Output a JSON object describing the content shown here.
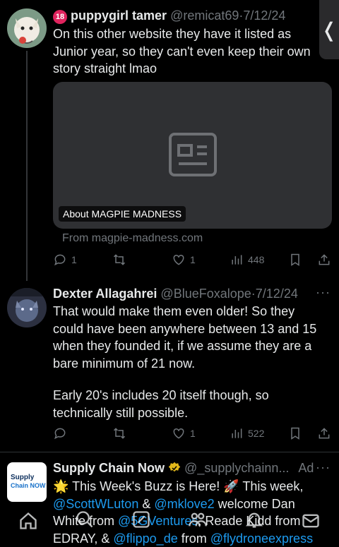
{
  "tweet1": {
    "age_badge": "18",
    "name": "puppygirl tamer",
    "handle": "@remicat69",
    "date": "7/12/24",
    "text": "On this other website they have it listed as Junior year, so they can't even keep their own story straight lmao",
    "card_label": "About MAGPIE MADNESS",
    "card_source": "From magpie-madness.com",
    "replies": "1",
    "retweets": "",
    "likes": "1",
    "views": "448"
  },
  "tweet2": {
    "name": "Dexter Allagahrei",
    "handle": "@BlueFoxalope",
    "date": "7/12/24",
    "text_p1": "That would make them even older! So they could have been anywhere between 13 and 15 when they founded it, if we assume they are a bare minimum of 21 now.",
    "text_p2": "Early 20's includes 20 itself though, so technically still possible.",
    "replies": "",
    "retweets": "",
    "likes": "1",
    "views": "522"
  },
  "ad": {
    "avatar_text_1": "Supply",
    "avatar_text_2": "Chain NOW",
    "name": "Supply Chain Now",
    "handle": "@_supplychainn...",
    "ad_label": "Ad",
    "line1": "🌟 This Week's Buzz is Here! 🚀 This week,",
    "mention1": "@ScottWLuton",
    "amp": " & ",
    "mention2": "@mklove2",
    "welcome": " welcome Dan",
    "line3a": "White from ",
    "mention3": "@5GVentures",
    "line3b": ", Reade Kidd from",
    "line4a": "EDRAY, & ",
    "mention4": "@flippo_de",
    "line4b": " from ",
    "mention5": "@flydroneexpress"
  },
  "sep": "·",
  "dots": "···",
  "side_tab": "❬",
  "colors": {
    "background": "#000000",
    "accent": "#1d9bf0",
    "muted": "#71767b",
    "text": "#e7e9ea"
  }
}
